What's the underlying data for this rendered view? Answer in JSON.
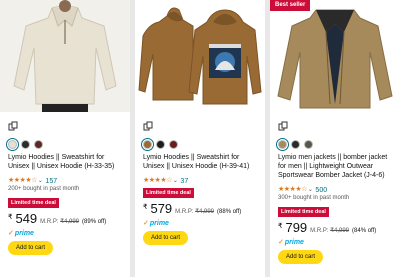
{
  "colors": {
    "star": "#de7921",
    "deal": "#cc0c39",
    "link": "#007185",
    "button": "#ffd814",
    "prime": "#00a8e1"
  },
  "products": [
    {
      "image_icon": "quarter-zip-hoodie-image",
      "swatch_colors": [
        "#e6e0d2",
        "#2b2b2b",
        "#5a2a22"
      ],
      "title": "Lymio Hoodies || Sweatshirt for Unisex || Unisex Hoodie (H-33-35)",
      "stars": "★★★★☆",
      "rating_value": 3.5,
      "review_count": "157",
      "bought": "200+ bought in past month",
      "deal": "Limited time deal",
      "currency": "₹",
      "price": "549",
      "mrp_label": "M.R.P:",
      "mrp": "₹4,999",
      "discount": "(89% off)",
      "prime": "prime",
      "add_to_cart": "Add to cart"
    },
    {
      "image_icon": "graphic-hoodie-image",
      "swatch_colors": [
        "#9a6a34",
        "#1d1d1d",
        "#6b1d1d"
      ],
      "title": "Lymio Hoodies || Sweatshirt for Unisex || Unisex Hoodie (H-39-41)",
      "stars": "★★★★☆",
      "rating_value": 4,
      "review_count": "37",
      "deal": "Limited time deal",
      "currency": "₹",
      "price": "579",
      "mrp_label": "M.R.P:",
      "mrp": "₹4,999",
      "discount": "(88% off)",
      "prime": "prime",
      "add_to_cart": "Add to cart"
    },
    {
      "image_icon": "bomber-jacket-image",
      "badge": "Best seller",
      "swatch_colors": [
        "#a78a5c",
        "#2a2a2a",
        "#555a48"
      ],
      "title": "Lymio men jackets || bomber jacket for men || Lightweight Outwear Sportswear Bomber Jacket (J-4-6)",
      "stars": "★★★★☆",
      "rating_value": 3.5,
      "review_count": "500",
      "bought": "300+ bought in past month",
      "deal": "Limited time deal",
      "currency": "₹",
      "price": "799",
      "mrp_label": "M.R.P:",
      "mrp": "₹4,999",
      "discount": "(84% off)",
      "prime": "prime",
      "add_to_cart": "Add to cart"
    }
  ]
}
